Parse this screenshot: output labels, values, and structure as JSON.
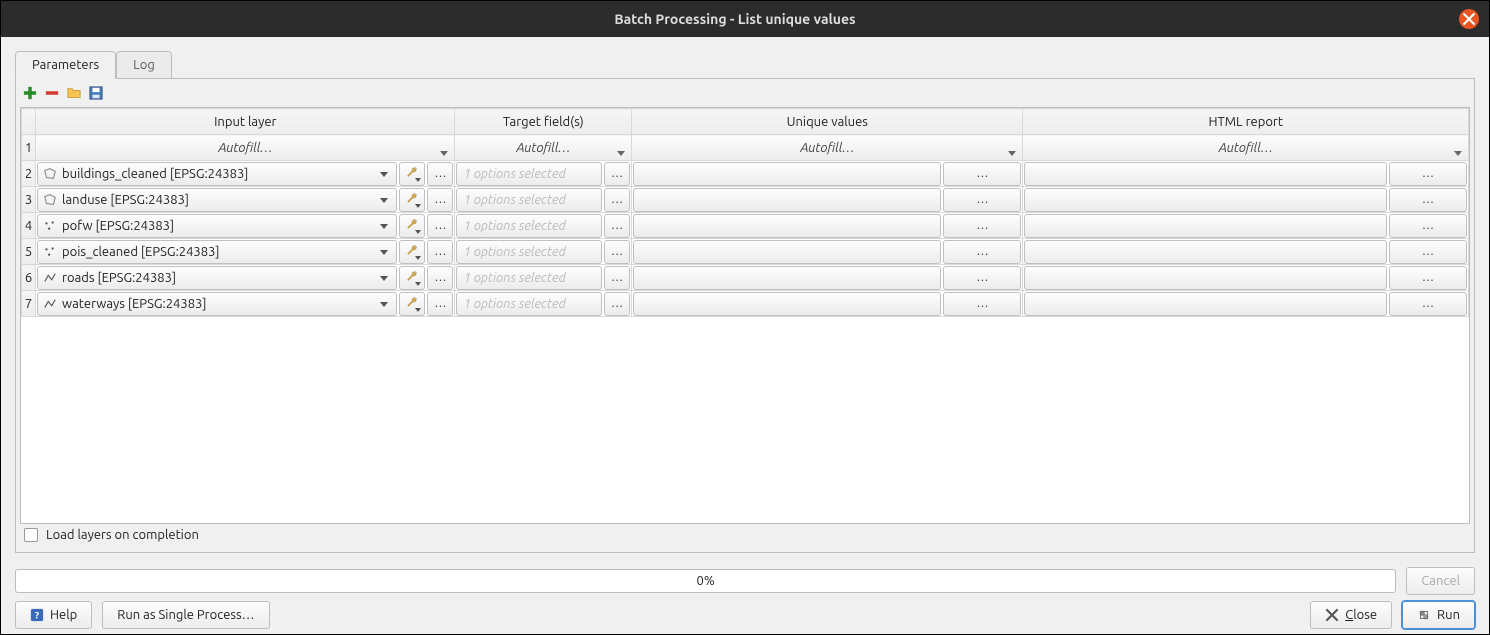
{
  "window": {
    "title": "Batch Processing - List unique values"
  },
  "tabs": {
    "parameters": "Parameters",
    "log": "Log"
  },
  "columns": {
    "input_layer": "Input layer",
    "target_fields": "Target field(s)",
    "unique_values": "Unique values",
    "html_report": "HTML report"
  },
  "autofill_label": "Autofill…",
  "ellipsis": "…",
  "field_placeholder": "1 options selected",
  "rows": [
    {
      "n": "1"
    },
    {
      "n": "2",
      "layer": "buildings_cleaned [EPSG:24383]",
      "geom": "polygon"
    },
    {
      "n": "3",
      "layer": "landuse [EPSG:24383]",
      "geom": "polygon"
    },
    {
      "n": "4",
      "layer": "pofw [EPSG:24383]",
      "geom": "point"
    },
    {
      "n": "5",
      "layer": "pois_cleaned [EPSG:24383]",
      "geom": "point"
    },
    {
      "n": "6",
      "layer": "roads [EPSG:24383]",
      "geom": "line"
    },
    {
      "n": "7",
      "layer": "waterways [EPSG:24383]",
      "geom": "line"
    }
  ],
  "checkbox_label": "Load layers on completion",
  "progress": "0%",
  "buttons": {
    "cancel": "Cancel",
    "help": "Help",
    "run_single": "Run as Single Process…",
    "close": "lose",
    "close_prefix": "C",
    "run": "Run"
  }
}
